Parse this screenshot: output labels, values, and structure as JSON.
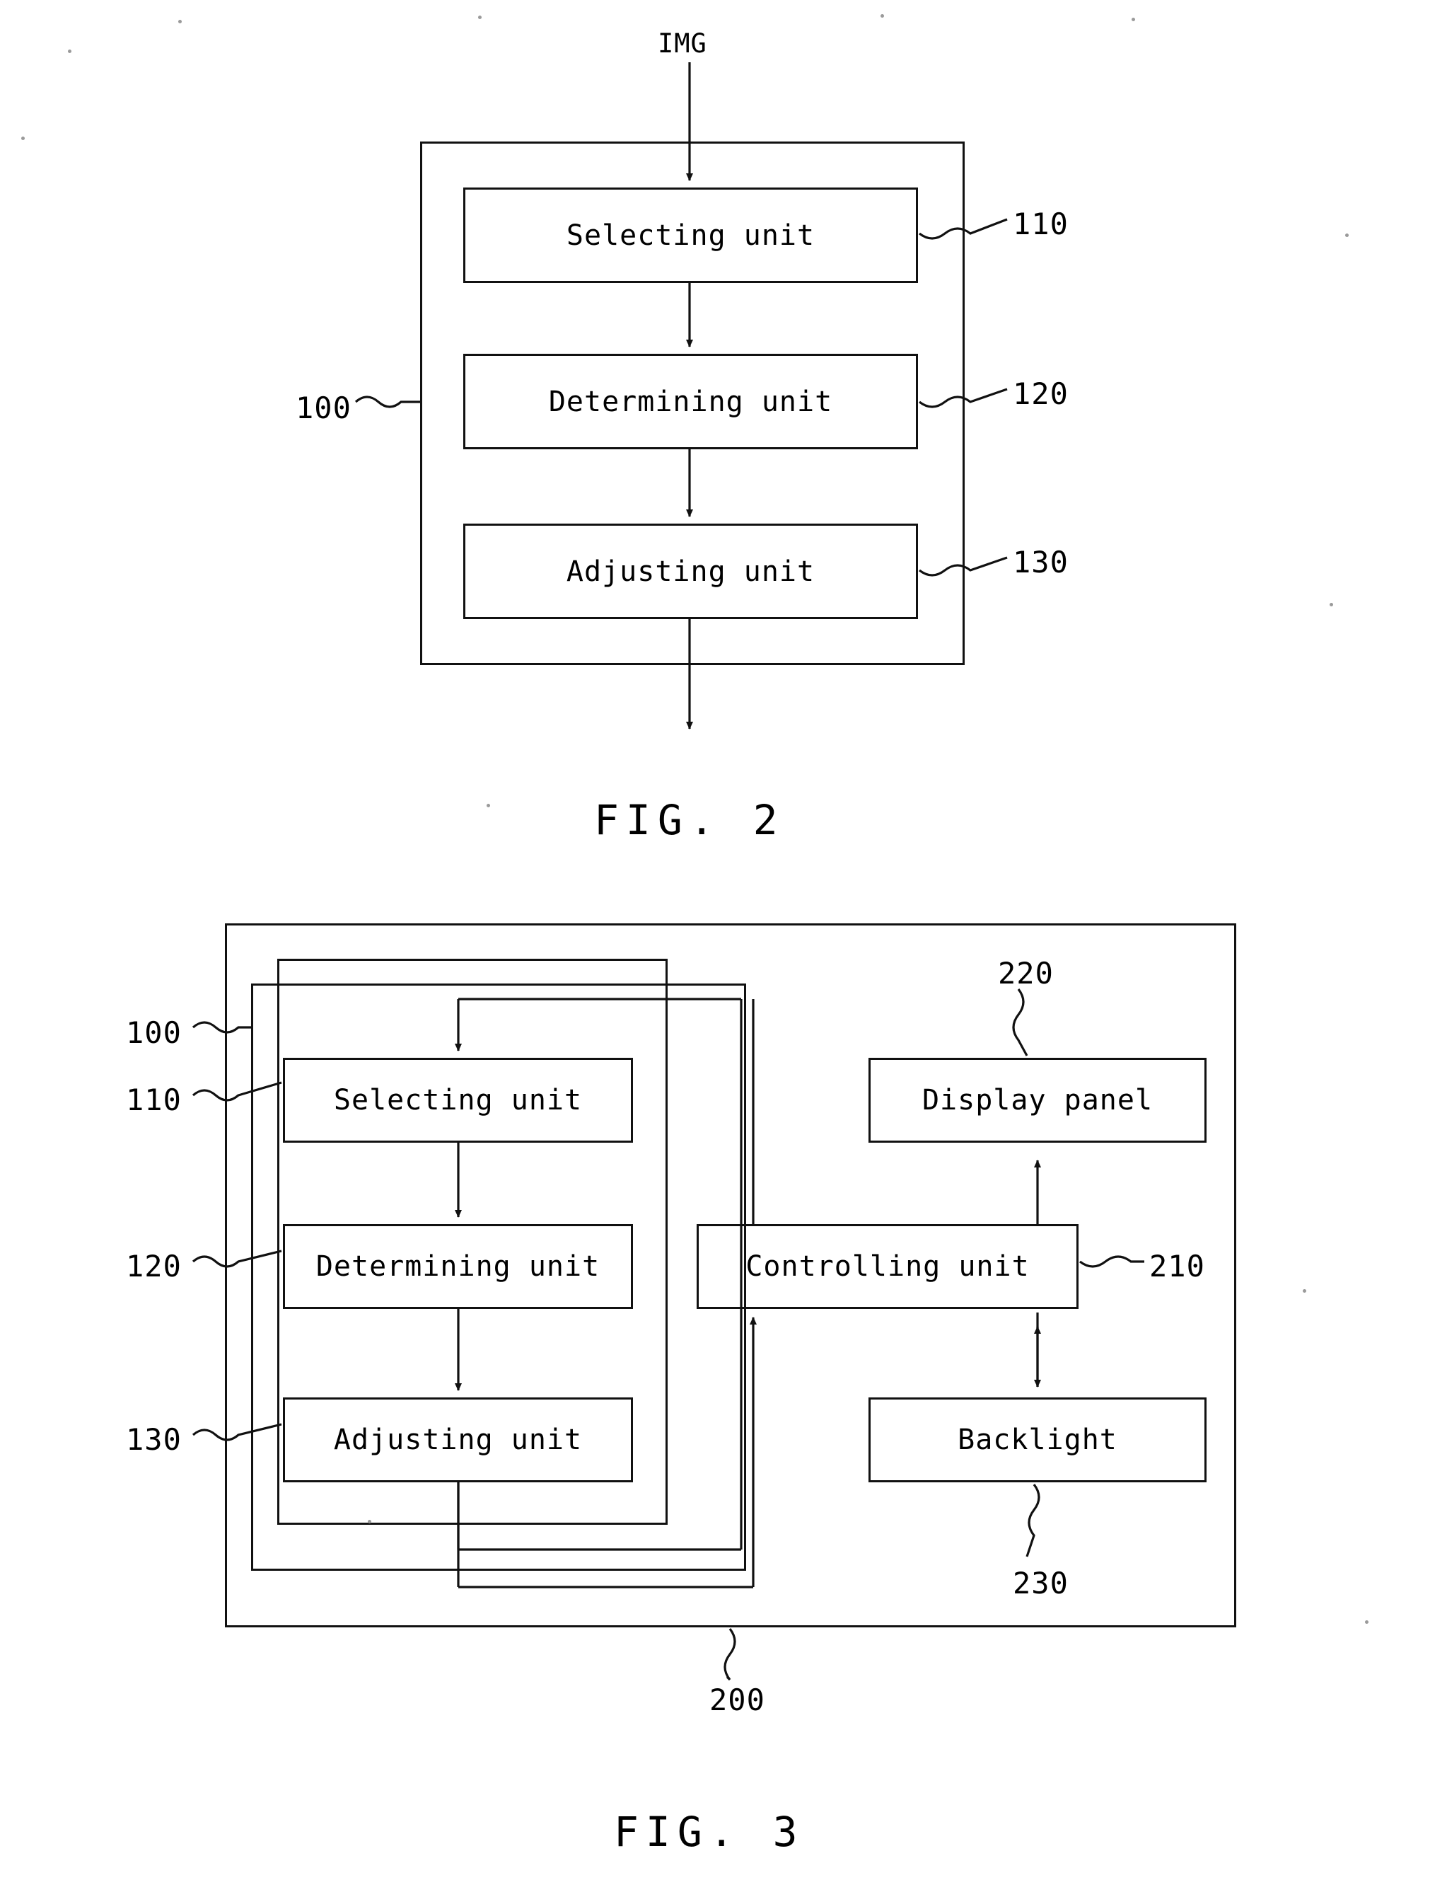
{
  "document": {
    "type": "patent-figure-sheet",
    "figures": [
      {
        "id": "fig2",
        "caption": "FIG.  2",
        "input_label": "IMG",
        "container_ref": "100",
        "blocks": [
          {
            "label": "Selecting unit",
            "ref": "110"
          },
          {
            "label": "Determining unit",
            "ref": "120"
          },
          {
            "label": "Adjusting unit",
            "ref": "130"
          }
        ]
      },
      {
        "id": "fig3",
        "caption": "FIG.  3",
        "container_ref": "200",
        "inner_container_ref": "100",
        "blocks": [
          {
            "label": "Selecting unit",
            "ref": "110"
          },
          {
            "label": "Determining unit",
            "ref": "120"
          },
          {
            "label": "Adjusting unit",
            "ref": "130"
          },
          {
            "label": "Controlling unit",
            "ref": "210"
          },
          {
            "label": "Display panel",
            "ref": "220"
          },
          {
            "label": "Backlight",
            "ref": "230"
          }
        ]
      }
    ]
  },
  "fig2": {
    "caption": "FIG.  2",
    "input_label": "IMG",
    "ref_100": "100",
    "block1": "Selecting unit",
    "ref_110": "110",
    "block2": "Determining unit",
    "ref_120": "120",
    "block3": "Adjusting unit",
    "ref_130": "130"
  },
  "fig3": {
    "caption": "FIG.  3",
    "ref_100": "100",
    "ref_110": "110",
    "ref_120": "120",
    "ref_130": "130",
    "ref_200": "200",
    "ref_210": "210",
    "ref_220": "220",
    "ref_230": "230",
    "block_selecting": "Selecting unit",
    "block_determining": "Determining unit",
    "block_adjusting": "Adjusting unit",
    "block_controlling": "Controlling unit",
    "block_display": "Display panel",
    "block_backlight": "Backlight"
  },
  "colors": {
    "ink": "#111111",
    "paper": "#ffffff"
  }
}
